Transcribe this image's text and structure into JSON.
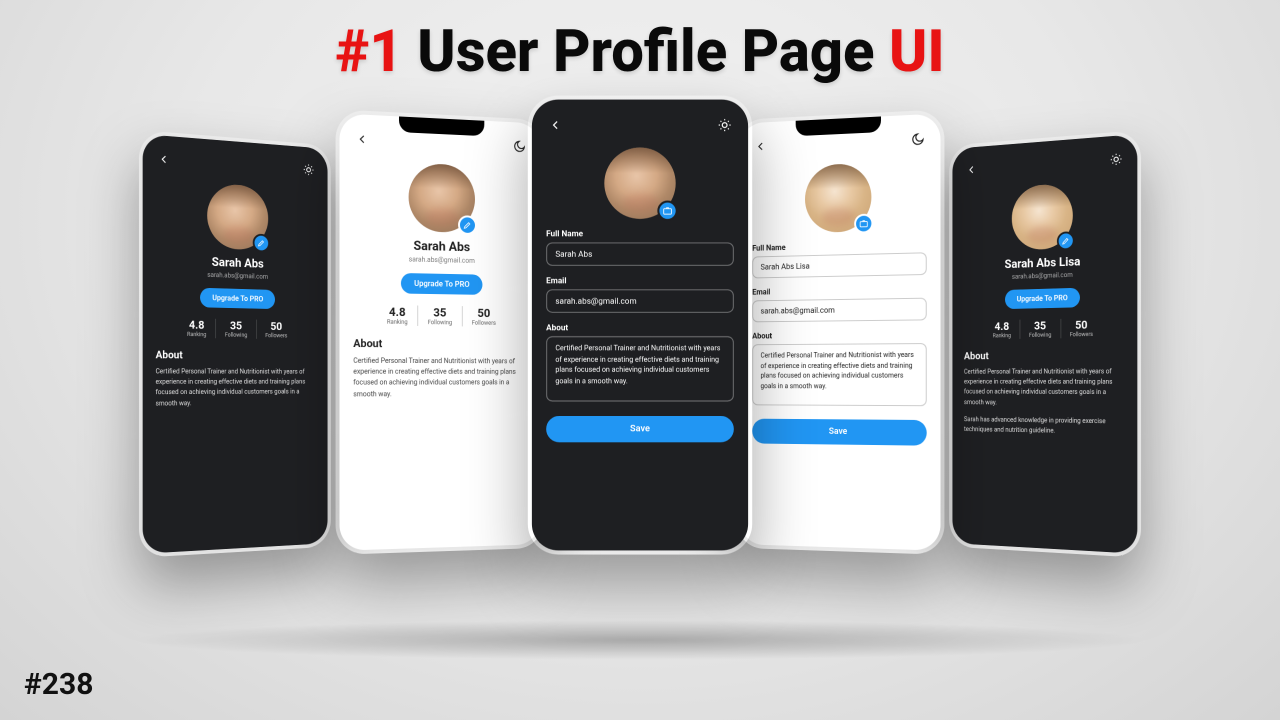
{
  "title": {
    "hash": "#1",
    "main": " User Profile Page ",
    "ui": "UI"
  },
  "footer": "#238",
  "profile": {
    "name_a": "Sarah Abs",
    "name_b": "Sarah Abs Lisa",
    "email": "sarah.abs@gmail.com",
    "upgrade_label": "Upgrade To PRO",
    "stats": {
      "ranking": {
        "value": "4.8",
        "label": "Ranking"
      },
      "following": {
        "value": "35",
        "label": "Following"
      },
      "followers": {
        "value": "50",
        "label": "Followers"
      }
    },
    "about_heading": "About",
    "about_text": "Certified Personal Trainer and Nutritionist with years of experience in creating effective diets and training plans focused on achieving individual customers goals in a smooth way.",
    "about_extra": "Sarah has advanced knowledge in providing exercise techniques and nutrition guideline."
  },
  "form": {
    "full_name_label": "Full Name",
    "name_value_a": "Sarah Abs",
    "name_value_b": "Sarah Abs Lisa",
    "email_label": "Email",
    "email_value": "sarah.abs@gmail.com",
    "about_label": "About",
    "about_value": "Certified Personal Trainer and Nutritionist with years of experience in creating effective diets and training plans focused on achieving individual customers goals in a smooth way.",
    "save_label": "Save"
  },
  "icons": {
    "back": "arrow-left-icon",
    "theme_sun": "sun-icon",
    "theme_moon": "moon-icon",
    "edit": "pencil-icon",
    "camera": "camera-icon"
  }
}
